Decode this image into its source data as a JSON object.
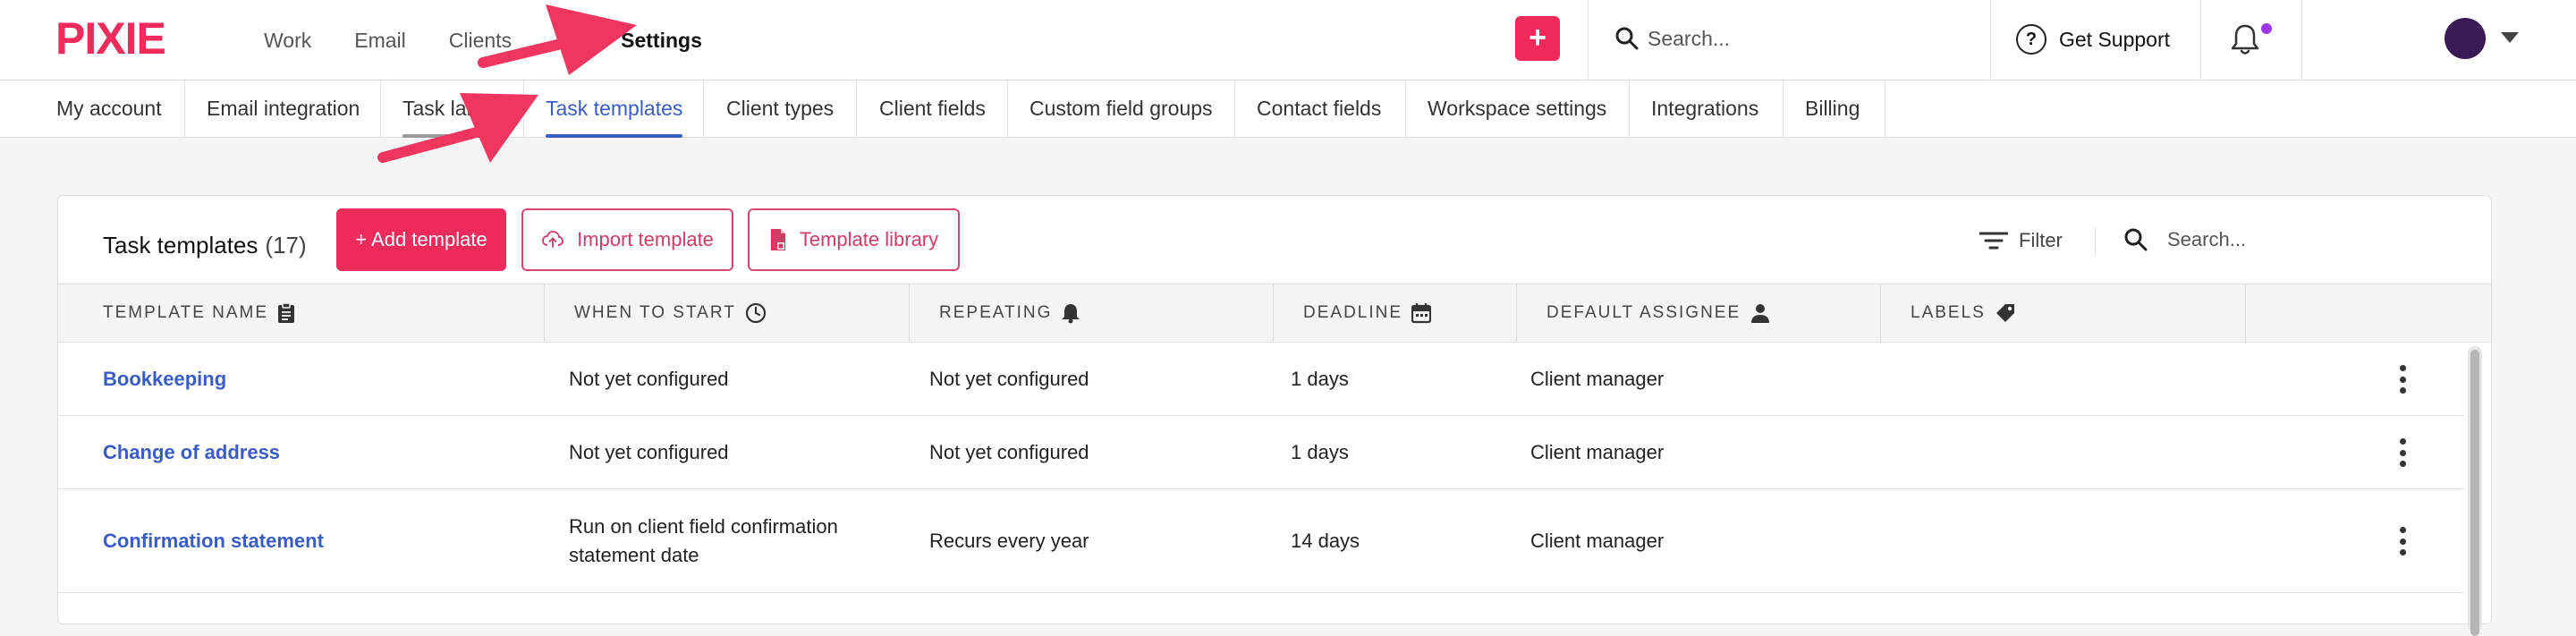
{
  "brand": {
    "logo_text": "PIXIE",
    "accent": "#f02a5b",
    "link_color": "#3a5cc5"
  },
  "top_nav": {
    "items": [
      "Work",
      "Email",
      "Clients",
      "T",
      "Settings"
    ],
    "active": "Settings"
  },
  "header": {
    "add_label": "+",
    "search_placeholder": "Search...",
    "support_label": "Get Support",
    "support_icon": "question-circle-icon",
    "notifications_icon": "bell-icon",
    "notification_dot_color": "#9b37e6",
    "avatar_color": "#3a1a55"
  },
  "settings_tabs": {
    "items": [
      "My account",
      "Email integration",
      "Task labels",
      "Task templates",
      "Client types",
      "Client fields",
      "Custom field groups",
      "Contact fields",
      "Workspace settings",
      "Integrations",
      "Billing"
    ],
    "visible_task_labels_text": "Task lab",
    "visible_task_labels_tail": "l",
    "active": "Task templates"
  },
  "card": {
    "title": "Task templates",
    "count": "(17)",
    "add_button": "+ Add template",
    "import_button": "Import template",
    "library_button": "Template library",
    "filter_label": "Filter",
    "search_placeholder": "Search..."
  },
  "table": {
    "columns": [
      {
        "label": "TEMPLATE NAME",
        "icon": "clipboard-icon"
      },
      {
        "label": "WHEN TO START",
        "icon": "clock-icon"
      },
      {
        "label": "REPEATING",
        "icon": "bell-icon"
      },
      {
        "label": "DEADLINE",
        "icon": "calendar-icon"
      },
      {
        "label": "DEFAULT ASSIGNEE",
        "icon": "person-icon"
      },
      {
        "label": "LABELS",
        "icon": "tag-icon"
      }
    ],
    "rows": [
      {
        "name": "Bookkeeping",
        "when_to_start": "Not yet configured",
        "repeating": "Not yet configured",
        "deadline": "1 days",
        "assignee": "Client manager",
        "labels": ""
      },
      {
        "name": "Change of address",
        "when_to_start": "Not yet configured",
        "repeating": "Not yet configured",
        "deadline": "1 days",
        "assignee": "Client manager",
        "labels": ""
      },
      {
        "name": "Confirmation statement",
        "when_to_start": "Run on client field confirmation statement date",
        "repeating": "Recurs every year",
        "deadline": "14 days",
        "assignee": "Client manager",
        "labels": ""
      }
    ]
  },
  "annotations": {
    "arrow_color": "#f0365e"
  }
}
